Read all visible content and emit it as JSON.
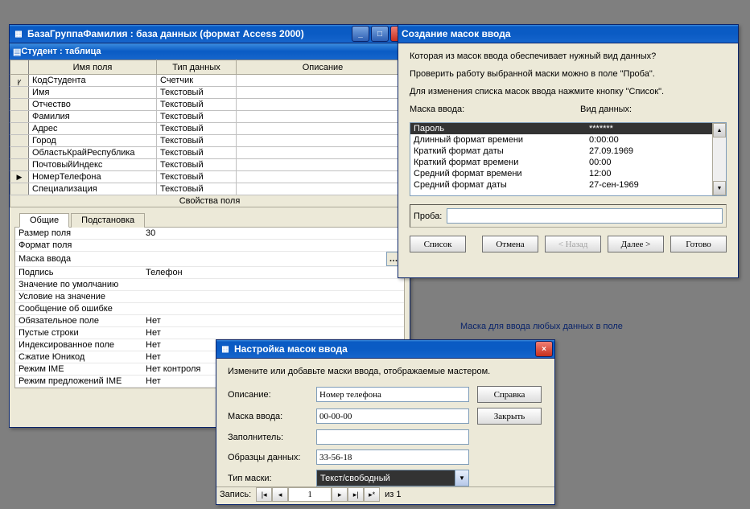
{
  "db_window": {
    "title": "БазаГруппаФамилия : база данных (формат Access 2000)",
    "table_title": "Студент : таблица",
    "cols": {
      "name": "Имя поля",
      "type": "Тип данных",
      "desc": "Описание"
    },
    "rows": [
      {
        "marker": "ꝩ",
        "name": "КодСтудента",
        "type": "Счетчик"
      },
      {
        "marker": "",
        "name": "Имя",
        "type": "Текстовый"
      },
      {
        "marker": "",
        "name": "Отчество",
        "type": "Текстовый"
      },
      {
        "marker": "",
        "name": "Фамилия",
        "type": "Текстовый"
      },
      {
        "marker": "",
        "name": "Адрес",
        "type": "Текстовый"
      },
      {
        "marker": "",
        "name": "Город",
        "type": "Текстовый"
      },
      {
        "marker": "",
        "name": "ОбластьКрайРеспублика",
        "type": "Текстовый"
      },
      {
        "marker": "",
        "name": "ПочтовыйИндекс",
        "type": "Текстовый"
      },
      {
        "marker": "▶",
        "name": "НомерТелефона",
        "type": "Текстовый"
      },
      {
        "marker": "",
        "name": "Специализация",
        "type": "Текстовый"
      }
    ],
    "props_header": "Свойства поля",
    "tabs": {
      "general": "Общие",
      "lookup": "Подстановка"
    },
    "props": [
      {
        "label": "Размер поля",
        "value": "30"
      },
      {
        "label": "Формат поля",
        "value": ""
      },
      {
        "label": "Маска ввода",
        "value": "",
        "builder": true
      },
      {
        "label": "Подпись",
        "value": "Телефон"
      },
      {
        "label": "Значение по умолчанию",
        "value": ""
      },
      {
        "label": "Условие на значение",
        "value": ""
      },
      {
        "label": "Сообщение об ошибке",
        "value": ""
      },
      {
        "label": "Обязательное поле",
        "value": "Нет"
      },
      {
        "label": "Пустые строки",
        "value": "Нет"
      },
      {
        "label": "Индексированное поле",
        "value": "Нет"
      },
      {
        "label": "Сжатие Юникод",
        "value": "Нет"
      },
      {
        "label": "Режим IME",
        "value": "Нет контроля"
      },
      {
        "label": "Режим предложений IME",
        "value": "Нет"
      }
    ],
    "help_text": "Маска для ввода любых данных в поле"
  },
  "wizard": {
    "title": "Создание масок ввода",
    "q1": "Которая из масок ввода обеспечивает нужный вид данных?",
    "q2": "Проверить работу выбранной маски можно в поле \"Проба\".",
    "q3": "Для изменения списка масок ввода нажмите кнопку \"Список\".",
    "col_mask": "Маска ввода:",
    "col_view": "Вид данных:",
    "items": [
      {
        "mask": "Пароль",
        "view": "*******",
        "sel": true
      },
      {
        "mask": "Длинный формат времени",
        "view": "0:00:00"
      },
      {
        "mask": "Краткий формат даты",
        "view": "27.09.1969"
      },
      {
        "mask": "Краткий формат времени",
        "view": "00:00"
      },
      {
        "mask": "Средний формат времени",
        "view": "12:00"
      },
      {
        "mask": "Средний формат даты",
        "view": "27-сен-1969"
      }
    ],
    "try_label": "Проба:",
    "btn_list": "Список",
    "btn_cancel": "Отмена",
    "btn_back": "< Назад",
    "btn_next": "Далее >",
    "btn_finish": "Готово"
  },
  "custom": {
    "title": "Настройка масок ввода",
    "intro": "Измените или добавьте маски ввода, отображаемые мастером.",
    "f_desc": "Описание:",
    "v_desc": "Номер телефона",
    "f_mask": "Маска ввода:",
    "v_mask": "00-00-00",
    "f_fill": "Заполнитель:",
    "v_fill": "",
    "f_sample": "Образцы данных:",
    "v_sample": "33-56-18",
    "f_type": "Тип маски:",
    "v_type": "Текст/свободный",
    "btn_help": "Справка",
    "btn_close": "Закрыть",
    "rec_label": "Запись:",
    "rec_pos": "1",
    "rec_of": "из  1"
  }
}
